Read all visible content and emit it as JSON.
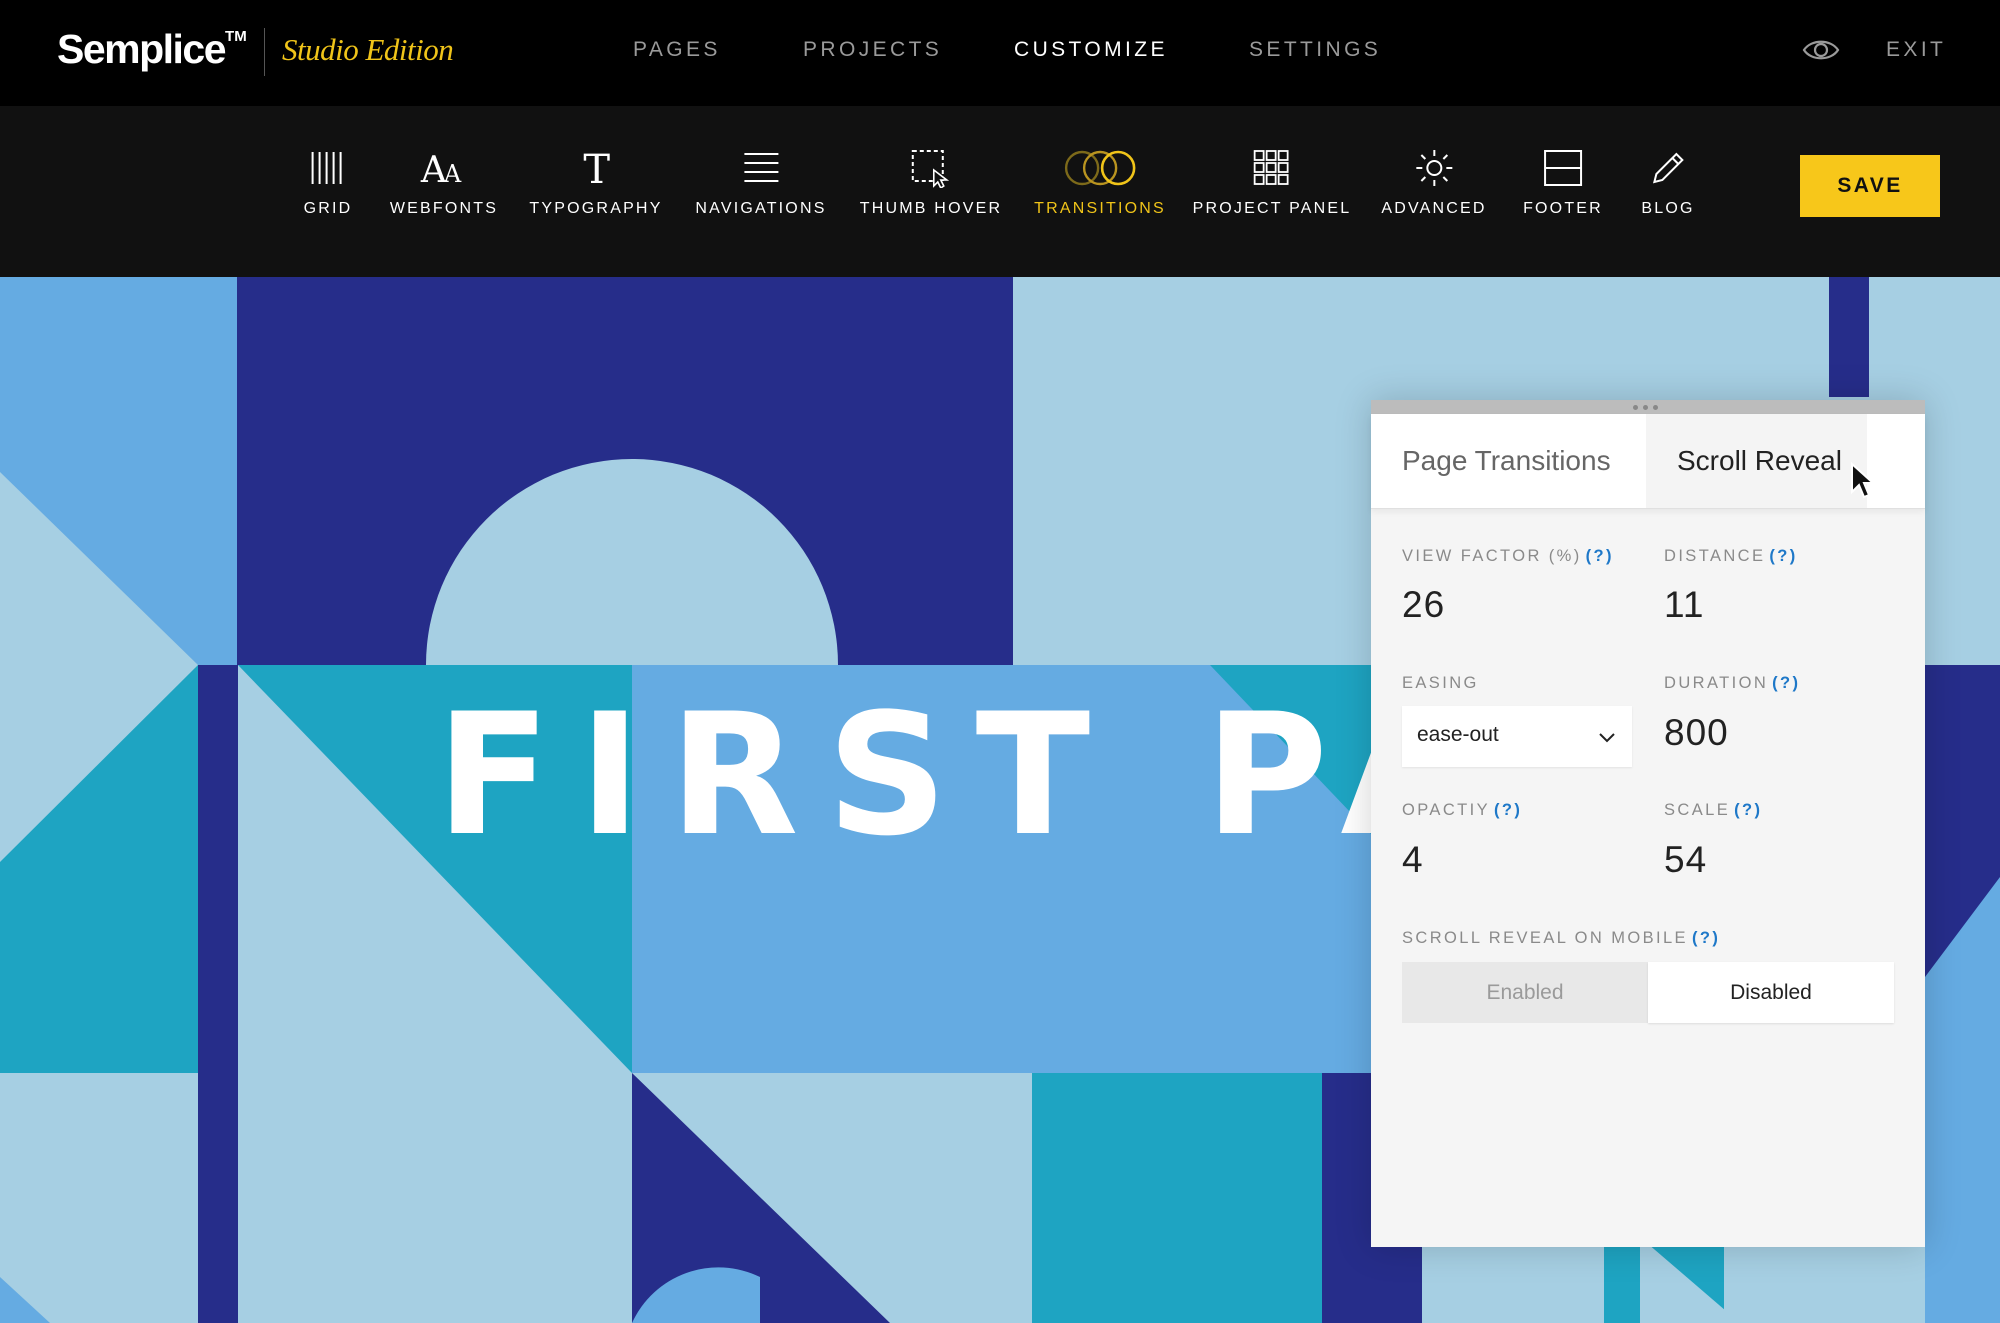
{
  "brand": {
    "logo": "Semplice",
    "trademark": "TM",
    "edition": "Studio Edition"
  },
  "topnav": {
    "items": [
      {
        "label": "PAGES"
      },
      {
        "label": "PROJECTS"
      },
      {
        "label": "CUSTOMIZE",
        "active": true
      },
      {
        "label": "SETTINGS"
      }
    ],
    "preview_icon": "eye-icon",
    "exit_label": "EXIT"
  },
  "toolbar": {
    "items": [
      {
        "label": "GRID",
        "icon": "grid-lines-icon"
      },
      {
        "label": "WEBFONTS",
        "icon": "webfonts-icon"
      },
      {
        "label": "TYPOGRAPHY",
        "icon": "typography-icon"
      },
      {
        "label": "NAVIGATIONS",
        "icon": "navigation-lines-icon"
      },
      {
        "label": "THUMB HOVER",
        "icon": "thumb-hover-icon"
      },
      {
        "label": "TRANSITIONS",
        "icon": "transitions-circles-icon",
        "active": true
      },
      {
        "label": "PROJECT PANEL",
        "icon": "project-panel-grid-icon"
      },
      {
        "label": "ADVANCED",
        "icon": "sun-icon"
      },
      {
        "label": "FOOTER",
        "icon": "footer-icon"
      },
      {
        "label": "BLOG",
        "icon": "pencil-icon"
      }
    ],
    "save_label": "SAVE"
  },
  "canvas": {
    "hero_text": "FIRST PAG"
  },
  "panel": {
    "tabs": [
      {
        "label": "Page Transitions"
      },
      {
        "label": "Scroll Reveal",
        "active": true
      }
    ],
    "help_label": "(?)",
    "fields": {
      "view_factor": {
        "label": "VIEW FACTOR (%)",
        "value": "26"
      },
      "distance": {
        "label": "DISTANCE",
        "value": "11"
      },
      "easing": {
        "label": "EASING",
        "value": "ease-out"
      },
      "duration": {
        "label": "DURATION",
        "value": "800"
      },
      "opacity": {
        "label": "OPACTIY",
        "value": "4"
      },
      "scale": {
        "label": "SCALE",
        "value": "54"
      }
    },
    "mobile": {
      "label": "SCROLL REVEAL ON MOBILE",
      "options": [
        "Enabled",
        "Disabled"
      ],
      "selected": "Disabled"
    }
  },
  "colors": {
    "accent_yellow": "#f7c71a",
    "topbar_bg": "#000000",
    "toolbar_bg": "#111111",
    "navy": "#262d8a",
    "teal": "#1ea4c2",
    "mid_blue": "#65abe2",
    "light_blue": "#a6cfe3",
    "help_blue": "#1e78c8"
  }
}
